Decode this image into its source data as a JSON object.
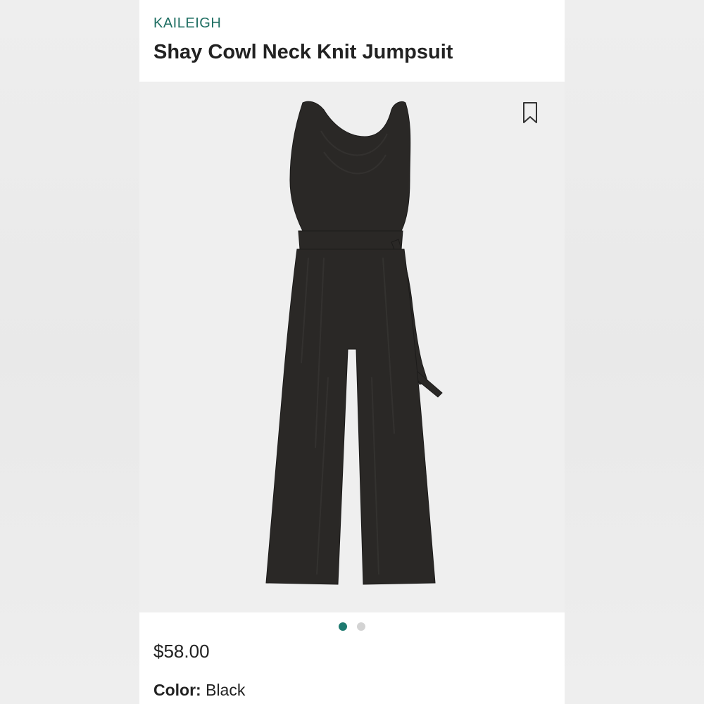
{
  "product": {
    "brand": "KAILEIGH",
    "title": "Shay Cowl Neck Knit Jumpsuit",
    "price": "$58.00",
    "color_label": "Color:",
    "color_value": "Black"
  },
  "gallery": {
    "image_count": 2,
    "active_index": 0
  },
  "icons": {
    "bookmark": "bookmark-icon"
  },
  "colors": {
    "brand": "#1e6e62",
    "dot_active": "#1e7a70",
    "dot_inactive": "#d3d3d3",
    "garment": "#2a2826"
  }
}
